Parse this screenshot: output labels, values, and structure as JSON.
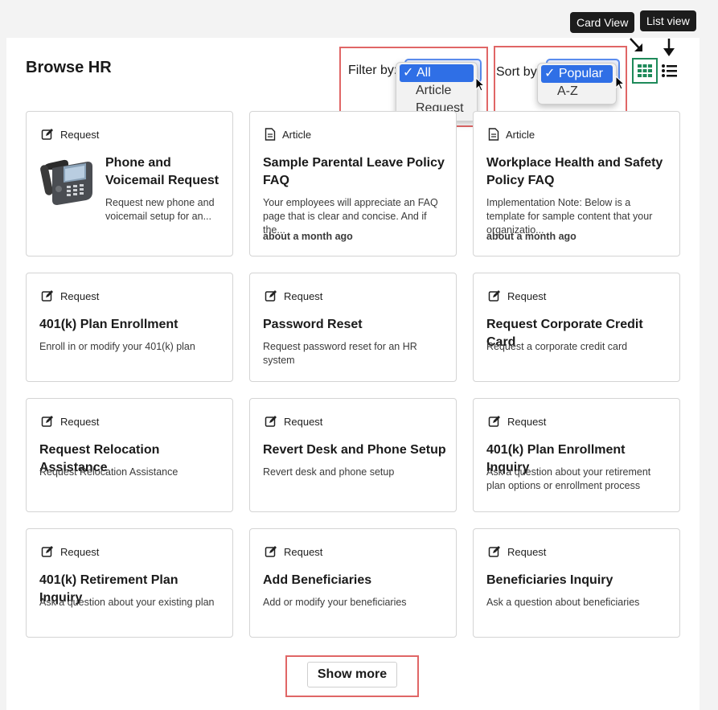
{
  "page": {
    "title": "Browse HR"
  },
  "tooltips": {
    "card_view": "Card View",
    "list_view": "List view"
  },
  "filter": {
    "label": "Filter by:",
    "options": [
      "All",
      "Article",
      "Request"
    ],
    "selected": "All"
  },
  "sort": {
    "label": "Sort by:",
    "options": [
      "Popular",
      "A-Z"
    ],
    "selected": "Popular"
  },
  "check_mark": "✓",
  "cards": [
    {
      "type": "Request",
      "type_icon": "edit-icon",
      "title": "Phone and Voicemail Request",
      "desc": "Request new phone and voicemail setup for an...",
      "time": "",
      "image": "ip-phone"
    },
    {
      "type": "Article",
      "type_icon": "document-icon",
      "title": "Sample Parental Leave Policy FAQ",
      "desc": "Your employees will appreciate an FAQ page that is clear and concise. And if the...",
      "time": "about a month ago"
    },
    {
      "type": "Article",
      "type_icon": "document-icon",
      "title": "Workplace Health and Safety Policy FAQ",
      "desc": "Implementation Note: Below is a template for sample content that your organizatio...",
      "time": "about a month ago"
    },
    {
      "type": "Request",
      "type_icon": "edit-icon",
      "title": "401(k) Plan Enrollment",
      "desc": "Enroll in or modify your 401(k) plan",
      "time": ""
    },
    {
      "type": "Request",
      "type_icon": "edit-icon",
      "title": "Password Reset",
      "desc": "Request password reset for an HR system",
      "time": ""
    },
    {
      "type": "Request",
      "type_icon": "edit-icon",
      "title": "Request Corporate Credit Card",
      "desc": "Request a corporate credit card",
      "time": ""
    },
    {
      "type": "Request",
      "type_icon": "edit-icon",
      "title": "Request Relocation Assistance",
      "desc": "Request Relocation Assistance",
      "time": ""
    },
    {
      "type": "Request",
      "type_icon": "edit-icon",
      "title": "Revert Desk and Phone Setup",
      "desc": "Revert desk and phone setup",
      "time": ""
    },
    {
      "type": "Request",
      "type_icon": "edit-icon",
      "title": "401(k) Plan Enrollment Inquiry",
      "desc": "Ask a question about your retirement plan options or enrollment process",
      "time": ""
    },
    {
      "type": "Request",
      "type_icon": "edit-icon",
      "title": "401(k) Retirement Plan Inquiry",
      "desc": "Ask a question about your existing plan",
      "time": ""
    },
    {
      "type": "Request",
      "type_icon": "edit-icon",
      "title": "Add Beneficiaries",
      "desc": "Add or modify your beneficiaries",
      "time": ""
    },
    {
      "type": "Request",
      "type_icon": "edit-icon",
      "title": "Beneficiaries Inquiry",
      "desc": "Ask a question about beneficiaries",
      "time": ""
    }
  ],
  "show_more": "Show more",
  "colors": {
    "highlight_box": "#e06666",
    "card_view_border": "#1e8a5a",
    "dropdown_selected": "#2f6fe6"
  }
}
